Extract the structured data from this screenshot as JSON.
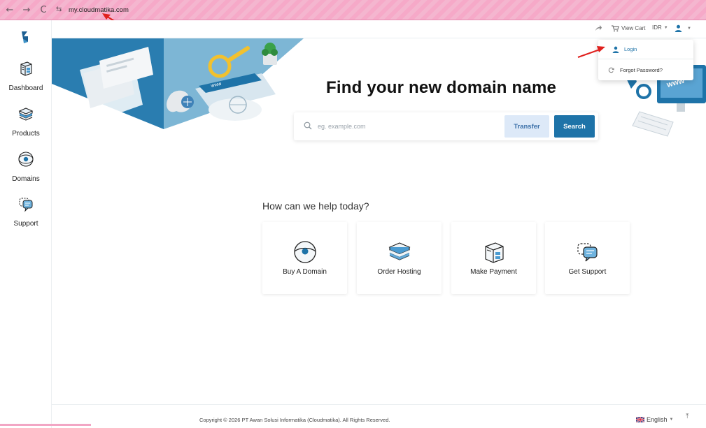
{
  "browser": {
    "url": "my.cloudmatika.com",
    "back_glyph": "←",
    "forward_glyph": "→",
    "reload_glyph": "C",
    "site_info_glyph": "⇆"
  },
  "sidebar": {
    "items": [
      {
        "label": "Dashboard",
        "icon": "dashboard-icon"
      },
      {
        "label": "Products",
        "icon": "products-icon"
      },
      {
        "label": "Domains",
        "icon": "domains-icon"
      },
      {
        "label": "Support",
        "icon": "support-icon"
      }
    ]
  },
  "topbar": {
    "view_cart": "View Cart",
    "currency": "IDR"
  },
  "dropdown": {
    "login": "Login",
    "forgot_password": "Forgot Password?"
  },
  "hero": {
    "title": "Find your new domain name",
    "search_placeholder": "eg. example.com",
    "transfer_label": "Transfer",
    "search_label": "Search",
    "illustration_tag": "www"
  },
  "help": {
    "title": "How can we help today?",
    "cards": [
      {
        "label": "Buy A Domain",
        "icon": "globe-icon"
      },
      {
        "label": "Order Hosting",
        "icon": "server-stack-icon"
      },
      {
        "label": "Make Payment",
        "icon": "package-icon"
      },
      {
        "label": "Get Support",
        "icon": "chat-bubbles-icon"
      }
    ]
  },
  "footer": {
    "copyright": "Copyright © 2026 PT Awan Solusi Informatika (Cloudmatika). All Rights Reserved.",
    "language": "English",
    "to_top_glyph": "⤒"
  },
  "colors": {
    "brand_blue": "#1e73a8",
    "transfer_bg": "#dde9f8",
    "annotation_red": "#e0201d",
    "browser_pink": "#f6a9c8"
  }
}
